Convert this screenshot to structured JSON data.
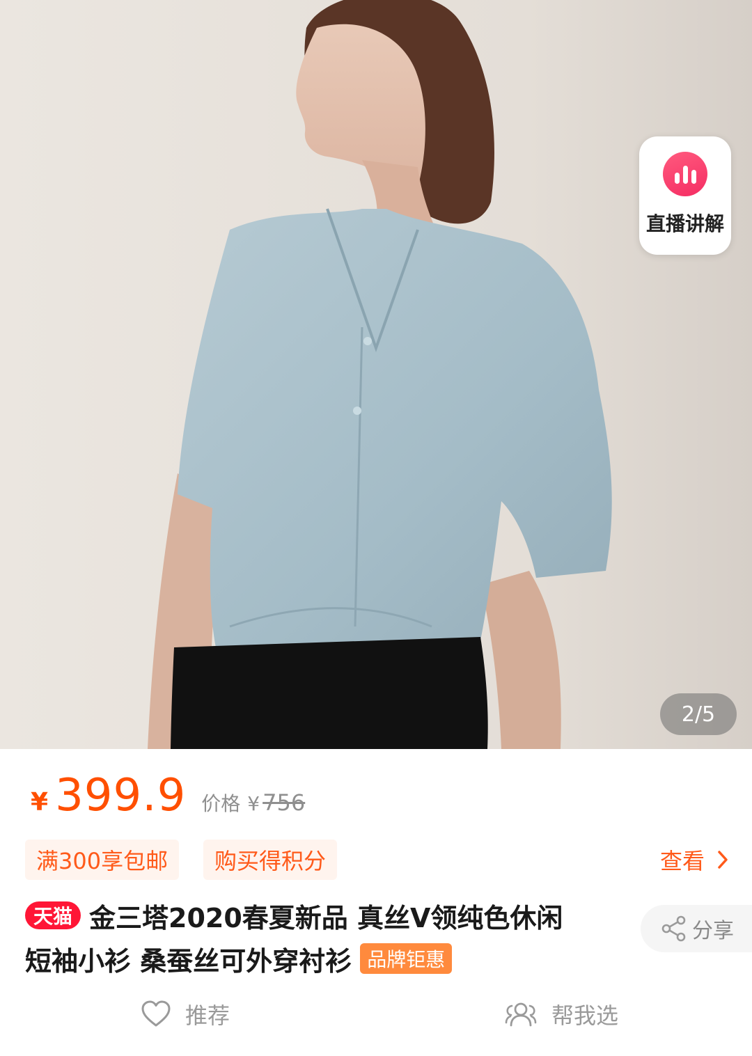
{
  "hero": {
    "image_alt": "product photo",
    "live_card": {
      "icon": "live-stats-icon",
      "label": "直播讲解"
    },
    "pager": "2/5"
  },
  "price": {
    "symbol": "¥",
    "value": "399.9",
    "original_label": "价格",
    "original_symbol": "¥",
    "original_value": "756",
    "color": "#ff4f00"
  },
  "promos": {
    "chips": [
      "满300享包邮",
      "购买得积分"
    ],
    "see_more": "查看"
  },
  "product": {
    "store_badge": "天猫",
    "title_line1": "金三塔2020春夏新品 真丝V领纯色休闲",
    "title_line2": "短袖小衫 桑蚕丝可外穿衬衫",
    "brand_badge": "品牌钜惠"
  },
  "share": {
    "icon": "share-icon",
    "label": "分享"
  },
  "actions": {
    "recommend": {
      "icon": "heart-icon",
      "label": "推荐"
    },
    "help_pick": {
      "icon": "group-users-icon",
      "label": "帮我选"
    }
  }
}
